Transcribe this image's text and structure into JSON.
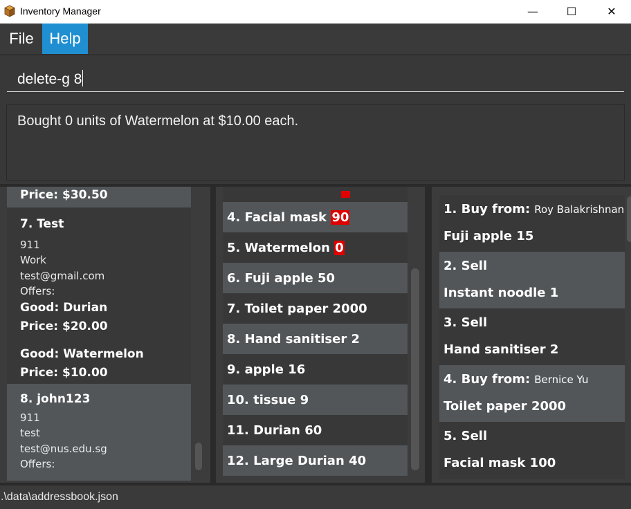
{
  "window": {
    "title": "Inventory Manager",
    "minimize_glyph": "—",
    "maximize_glyph": "☐",
    "close_glyph": "✕",
    "icon": "box-icon"
  },
  "menu": {
    "file": "File",
    "help": "Help",
    "active_color": "#1f8fd1"
  },
  "command": {
    "value": "delete-g 8"
  },
  "result": {
    "text": "Bought 0 units of Watermelon at $10.00 each."
  },
  "persons": {
    "partial_price": "Price: $30.50",
    "items": [
      {
        "index_name": "7.  Test",
        "phone": "911",
        "address": "Work",
        "email": "test@gmail.com",
        "offers_label": "Offers:",
        "offers": [
          {
            "good": "Good: Durian",
            "price": "Price: $20.00"
          },
          {
            "good": "Good: Watermelon",
            "price": "Price: $10.00"
          }
        ]
      },
      {
        "index_name": "8.  john123",
        "phone": "911",
        "address": "test",
        "email": "test@nus.edu.sg",
        "offers_label": "Offers:"
      }
    ]
  },
  "goods": {
    "items": [
      {
        "name": "4.  Facial mask",
        "qty": "90",
        "low_stock": true
      },
      {
        "name": "5.  Watermelon",
        "qty": "0",
        "low_stock": true
      },
      {
        "name": "6.  Fuji apple",
        "qty": "50",
        "low_stock": false
      },
      {
        "name": "7.  Toilet paper",
        "qty": "2000",
        "low_stock": false
      },
      {
        "name": "8.  Hand sanitiser",
        "qty": "2",
        "low_stock": false
      },
      {
        "name": "9.  apple",
        "qty": "16",
        "low_stock": false
      },
      {
        "name": "10.  tissue",
        "qty": "9",
        "low_stock": false
      },
      {
        "name": "11.  Durian",
        "qty": "60",
        "low_stock": false
      },
      {
        "name": "12.  Large Durian",
        "qty": "40",
        "low_stock": false
      }
    ],
    "low_stock_color": "#e00000"
  },
  "transactions": {
    "items": [
      {
        "head": "1.  Buy from:",
        "party": "Roy Balakrishnan",
        "good": "Fuji apple 15"
      },
      {
        "head": "2.  Sell",
        "party": "",
        "good": "Instant noodle 1"
      },
      {
        "head": "3.  Sell",
        "party": "",
        "good": "Hand sanitiser 2"
      },
      {
        "head": "4.  Buy from:",
        "party": "Bernice Yu",
        "good": "Toilet paper 2000"
      },
      {
        "head": "5.  Sell",
        "party": "",
        "good": "Facial mask 100"
      }
    ]
  },
  "status": {
    "path": ".\\data\\addressbook.json"
  }
}
